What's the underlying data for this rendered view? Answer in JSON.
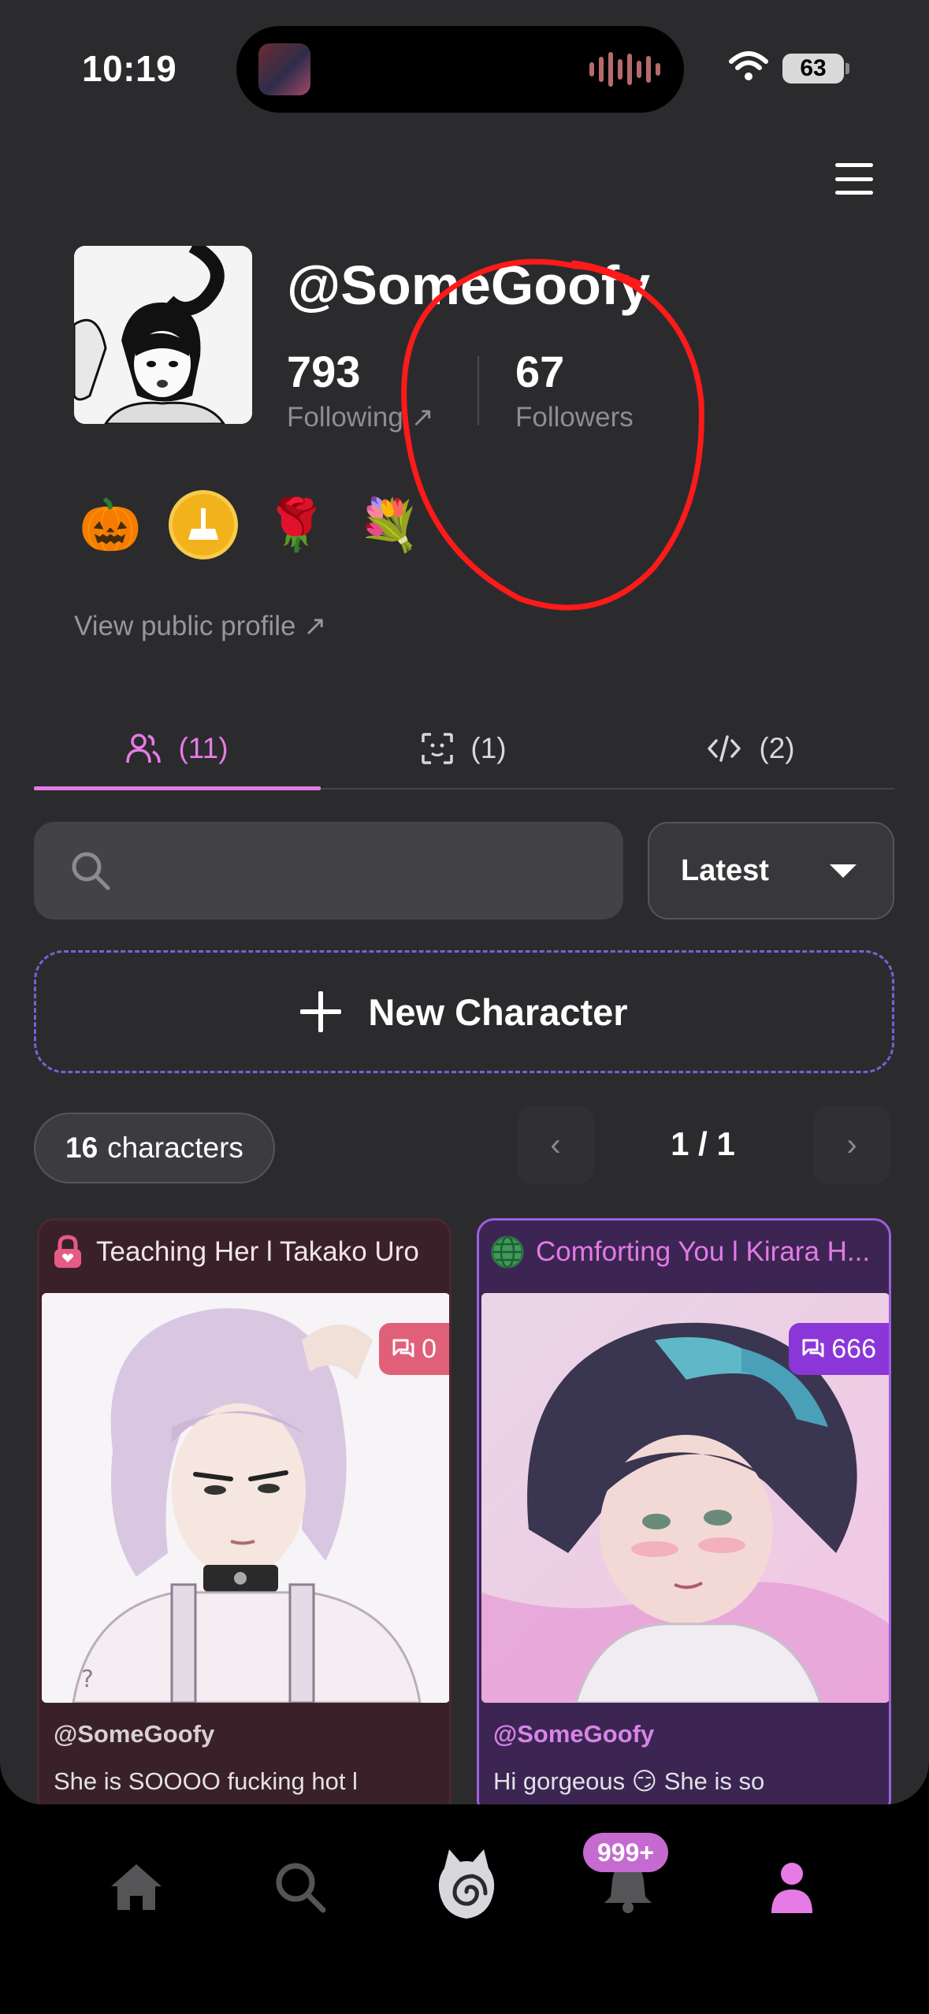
{
  "status_bar": {
    "time": "10:19",
    "battery": "63"
  },
  "profile": {
    "username": "@SomeGoofy",
    "following_count": "793",
    "following_label": "Following ↗",
    "followers_count": "67",
    "followers_label": "Followers",
    "badges": [
      "pumpkin-badge",
      "broom-coin-badge",
      "roses-badge",
      "bouquet-badge"
    ],
    "view_public_profile": "View public profile ↗"
  },
  "tabs": [
    {
      "icon": "users-icon",
      "label": "(11)",
      "active": true
    },
    {
      "icon": "face-scan-icon",
      "label": "(1)",
      "active": false
    },
    {
      "icon": "code-icon",
      "label": "(2)",
      "active": false
    }
  ],
  "search": {
    "placeholder": ""
  },
  "sort": {
    "selected": "Latest"
  },
  "new_character_label": "New Character",
  "character_count": {
    "number": "16",
    "label": "characters"
  },
  "pagination": {
    "prev": "‹",
    "page": "1 / 1",
    "next": "›"
  },
  "cards": [
    {
      "title_icon": "lock-icon",
      "title": "Teaching Her l Takako Uro",
      "chat_count": "0",
      "author": "@SomeGoofy",
      "description": "She is SOOOO fucking hot l"
    },
    {
      "title_icon": "globe-icon",
      "title": "Comforting You l Kirara H...",
      "chat_count": "666",
      "author": "@SomeGoofy",
      "description": "Hi gorgeous 😏 She is so"
    }
  ],
  "bottom_nav": {
    "items": [
      "home-icon",
      "search-icon",
      "spiral-cat-icon",
      "bell-icon",
      "profile-icon"
    ],
    "notification_badge": "999+"
  },
  "colors": {
    "background": "#2b2b2e",
    "accent_pink": "#e67be6",
    "dashed_border": "#7a60d8",
    "annotation_red": "#ff1a1a"
  }
}
